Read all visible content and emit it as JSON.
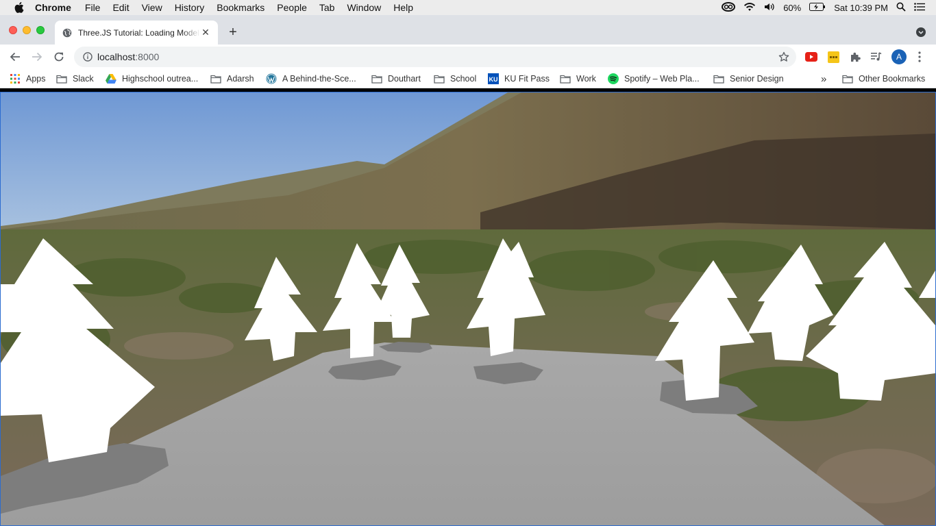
{
  "menubar": {
    "app_name": "Chrome",
    "items": [
      "File",
      "Edit",
      "View",
      "History",
      "Bookmarks",
      "People",
      "Tab",
      "Window",
      "Help"
    ],
    "battery": "60%",
    "clock": "Sat 10:39 PM"
  },
  "tab": {
    "title": "Three.JS Tutorial: Loading Models",
    "close_label": "✕",
    "new_tab_label": "+"
  },
  "toolbar": {
    "url_host": "localhost",
    "url_port": ":8000",
    "avatar_initial": "A"
  },
  "bookmarks": {
    "items": [
      {
        "label": "Apps",
        "icon": "apps-grid-icon"
      },
      {
        "label": "Slack",
        "icon": "folder-icon"
      },
      {
        "label": "Highschool outrea...",
        "icon": "google-drive-icon"
      },
      {
        "label": "Adarsh",
        "icon": "folder-icon"
      },
      {
        "label": "A Behind-the-Sce...",
        "icon": "wordpress-icon"
      },
      {
        "label": "Douthart",
        "icon": "folder-icon"
      },
      {
        "label": "School",
        "icon": "folder-icon"
      },
      {
        "label": "KU Fit Pass",
        "icon": "ku-icon"
      },
      {
        "label": "Work",
        "icon": "folder-icon"
      },
      {
        "label": "Spotify – Web Pla...",
        "icon": "spotify-icon"
      },
      {
        "label": "Senior Design",
        "icon": "folder-icon"
      }
    ],
    "overflow_label": "»",
    "other_label": "Other Bookmarks"
  },
  "scene": {
    "description_colors": {
      "sky": "#8fb4e0",
      "ground_plane": "#a3a3a3",
      "tree": "#ffffff",
      "shadow": "#7d7d7d"
    }
  }
}
